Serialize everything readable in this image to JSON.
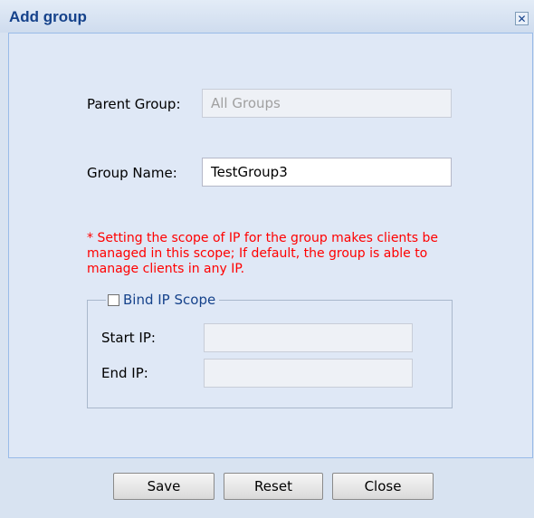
{
  "dialog": {
    "title": "Add group",
    "close_glyph": "✕"
  },
  "form": {
    "parent_group_label": "Parent Group:",
    "parent_group_value": "All Groups",
    "group_name_label": "Group Name:",
    "group_name_value": "TestGroup3",
    "scope_note": "* Setting the scope of IP for the group makes clients be managed in this scope; If default, the group is able to manage clients in any IP.",
    "bind_ip_scope_label": "Bind IP Scope",
    "bind_ip_scope_checked": false,
    "start_ip_label": "Start IP:",
    "start_ip_value": "",
    "end_ip_label": "End IP:",
    "end_ip_value": ""
  },
  "buttons": {
    "save": "Save",
    "reset": "Reset",
    "close": "Close"
  }
}
